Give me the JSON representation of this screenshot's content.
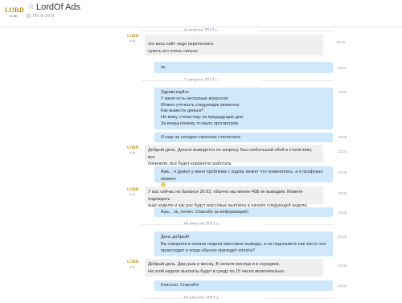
{
  "contact": {
    "name": "LordOf Ads",
    "status": "Не в сети",
    "logo_text": "LORD",
    "logo_sub": "of ads"
  },
  "dates": [
    "4 августа 2017 г.",
    "7 августа 2017 г.",
    "14 августа 2017 г.",
    "18 августа 2017 г."
  ],
  "messages": [
    {
      "lines": [
        "это весь сайт надо переползать",
        "сузить его очень сильно"
      ],
      "time": "19:45"
    },
    {
      "lines": [
        "ок"
      ],
      "time": "19:47"
    },
    {
      "lines": [
        "Здравствуйте",
        "У меня есть несколько вопросов",
        "Можно уточнить следующие моменты:",
        "Как вывести деньги?",
        "Не вижу статистику за предыдущие дни.",
        "За вчера почему то мало просмотров"
      ],
      "time": "13:26"
    },
    {
      "lines": [
        "И еще за сегодня странная статистика"
      ],
      "time": "13:28"
    },
    {
      "lines": [
        "Добрый день. Деньги выводятся по запросу. Был небольшой сбой в статистике, все",
        "починили, все будет корректно работать."
      ],
      "time": "13:24"
    },
    {
      "lines": [
        "Ааа... я думал у меня проблема с кодом, может что поменялось, а я профукал момент"
      ],
      "time": "13:45"
    },
    {
      "lines": [
        "У вас сейчас на балансе 26.62, обычно мы менее 40$ не выводим. Можете подождать",
        "ещё неделю и как раз будут массовые выплаты в начале следующей недели."
      ],
      "time": "13:33"
    },
    {
      "lines": [
        "Ааа... ок, понял. Спасибо за информацию!"
      ],
      "time": "13:45"
    },
    {
      "lines": [
        "День добрый!",
        "Вы говорили в начале недели массовые выводы, а не подскажете как часто оно",
        "происходит и когда обычно приходит оплата?"
      ],
      "time": "10:28"
    },
    {
      "lines": [
        "Добрый день. Два раза в месяц. В начале месяца и в середине.",
        "На этой неделе выплаты будут в среду по 15 число включительно."
      ],
      "time": "10:30"
    },
    {
      "lines": [
        "Классно. Спасибо!"
      ],
      "time": "10:42"
    }
  ]
}
